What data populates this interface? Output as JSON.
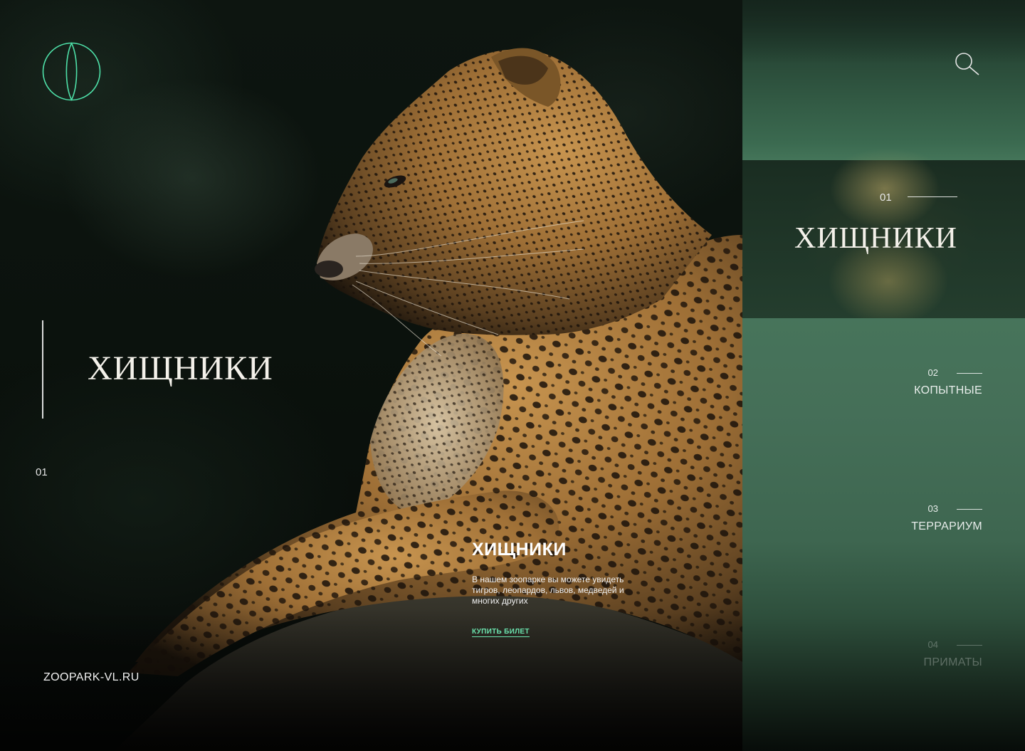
{
  "brand": {
    "logo_icon": "eye-iris-logo-icon",
    "accent_color": "#4ee0a8",
    "site_url": "ZOOPARK-VL.RU"
  },
  "hero": {
    "title": "ХИЩНИКИ",
    "index": "01",
    "image_subject": "leopard-photo",
    "card": {
      "title": "ХИЩНИКИ",
      "text": "В нашем зоопарке вы можете увидеть тигров, леопардов, львов, медведей и многих других",
      "cta": "КУПИТЬ БИЛЕТ",
      "cta_color": "#6be3ae"
    }
  },
  "side": {
    "search_icon": "search-icon",
    "active": {
      "number": "01",
      "label": "ХИЩНИКИ"
    },
    "items": [
      {
        "number": "02",
        "label": "КОПЫТНЫЕ"
      },
      {
        "number": "03",
        "label": "ТЕРРАРИУМ"
      },
      {
        "number": "04",
        "label": "ПРИМАТЫ"
      }
    ],
    "panel_color": "#4a7c5f"
  }
}
